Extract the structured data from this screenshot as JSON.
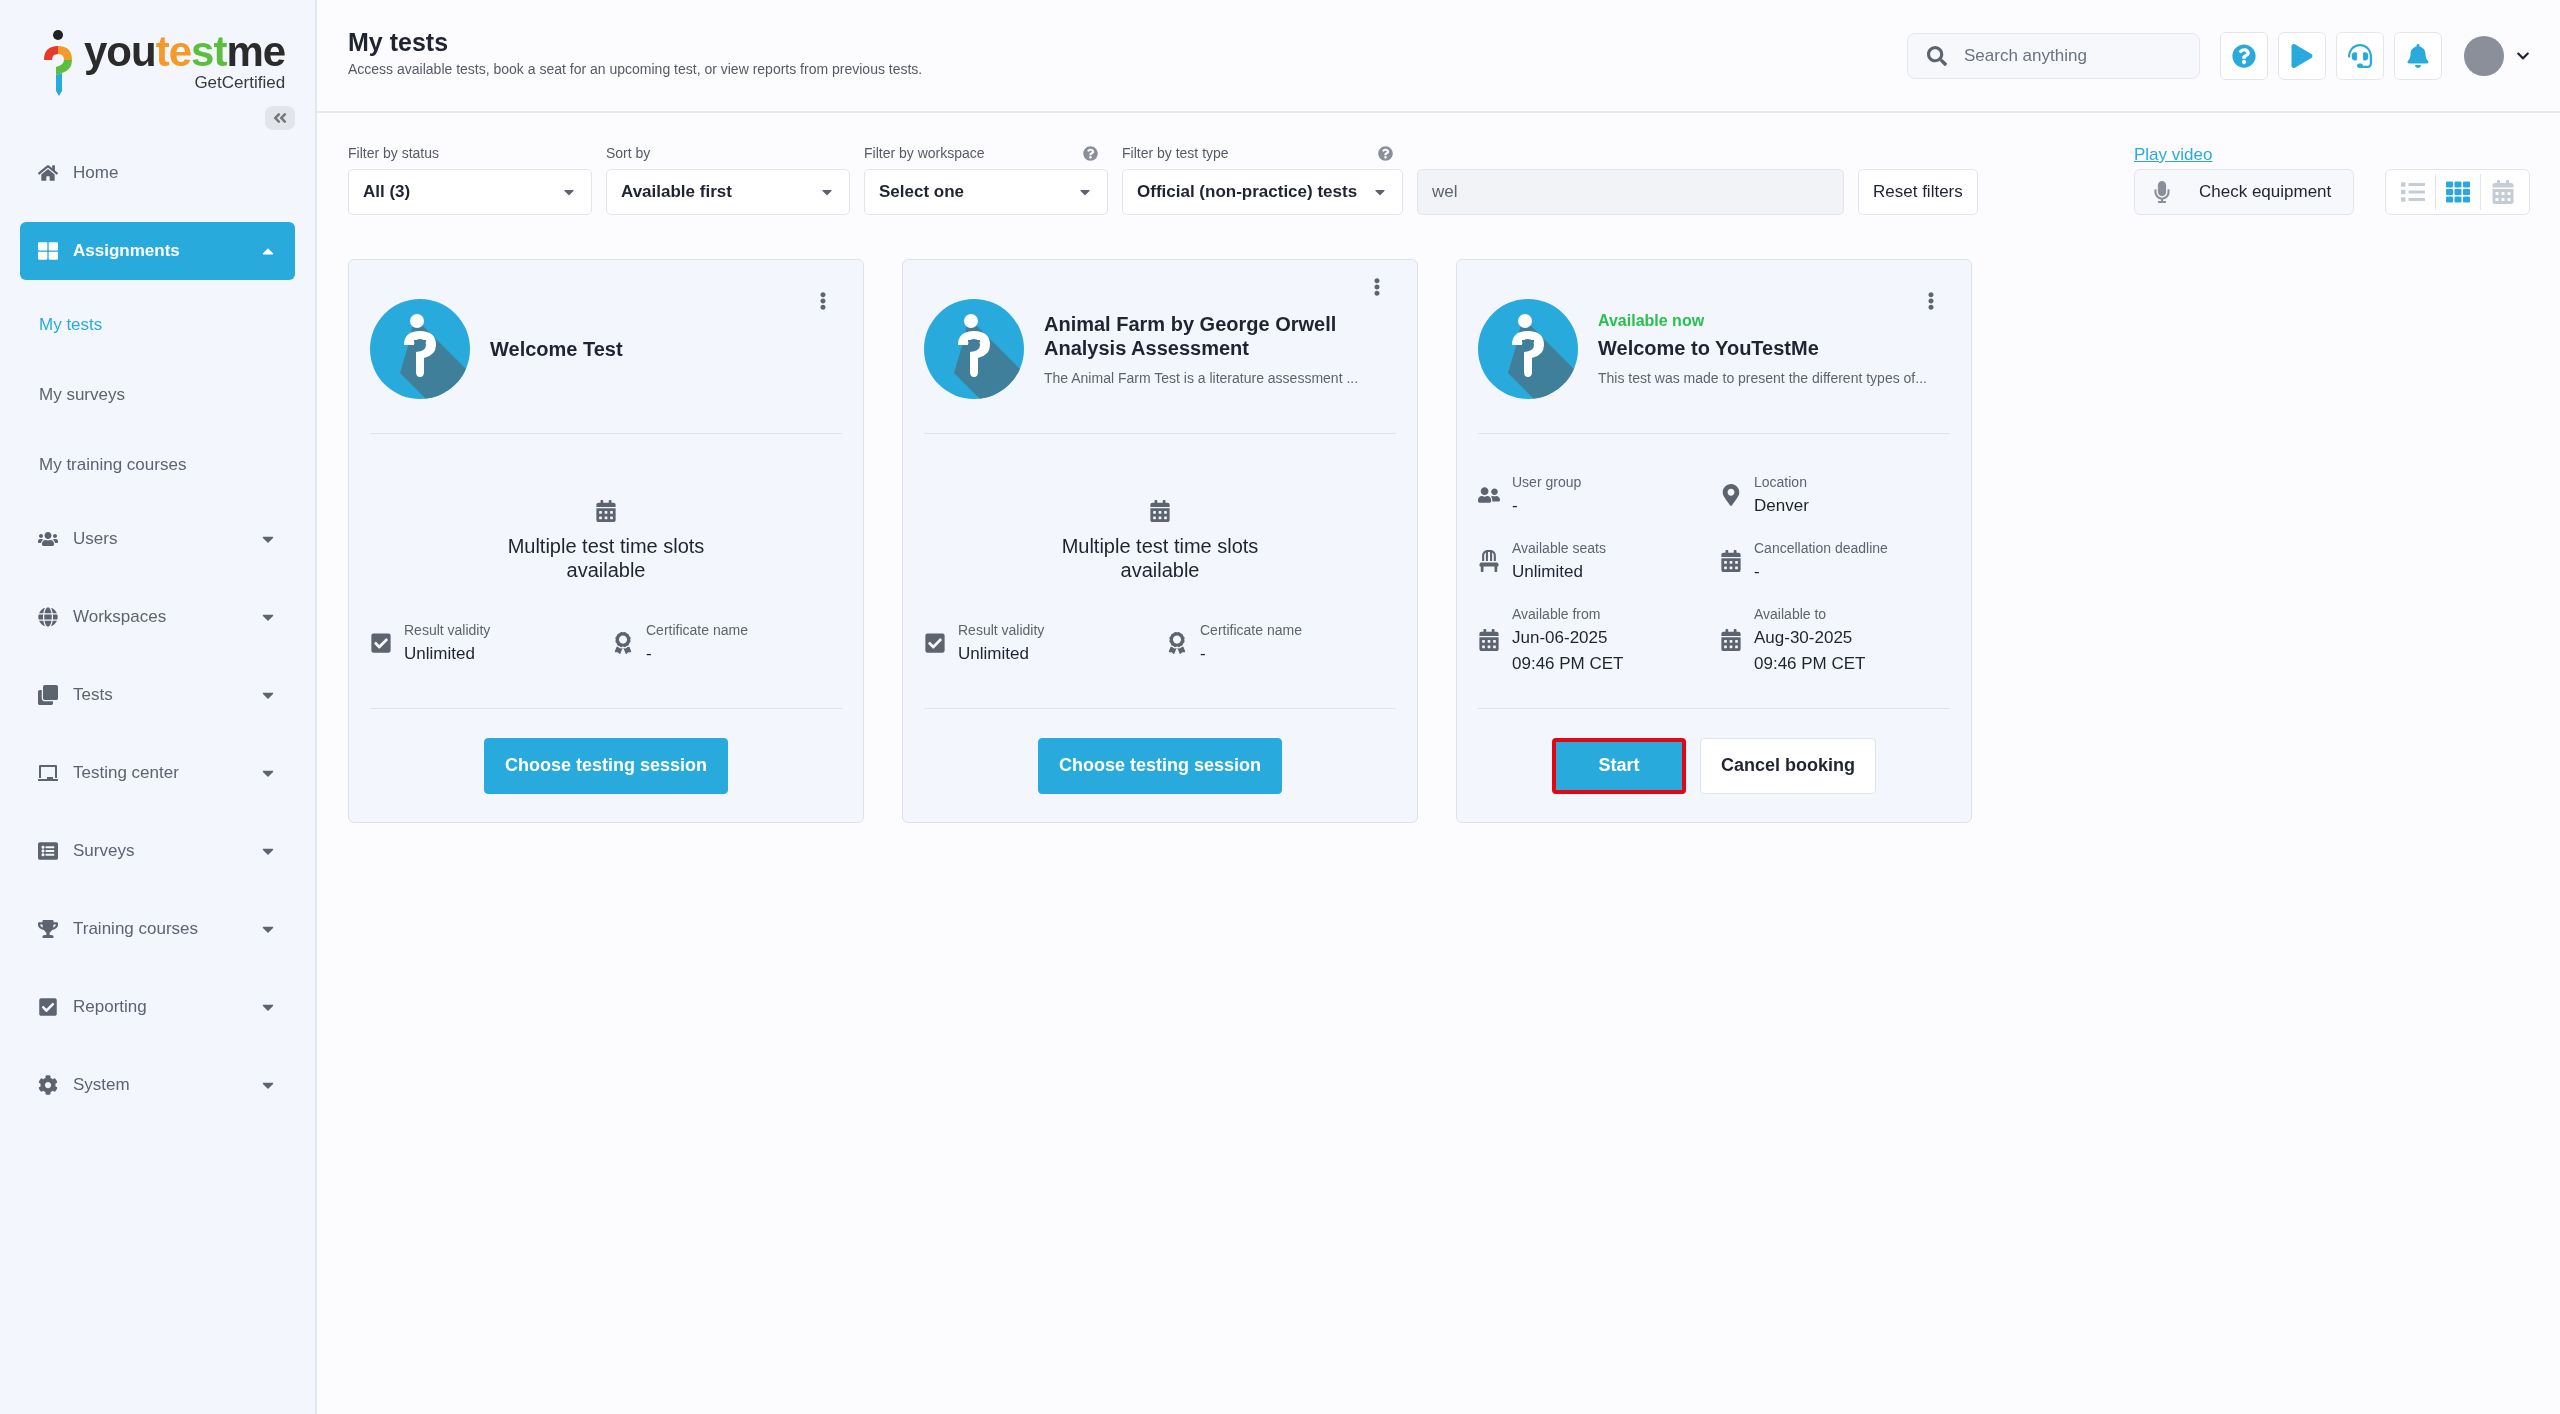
{
  "sidebar": {
    "logo": {
      "wordmark": [
        {
          "text": "you",
          "color": "#2b2b2b"
        },
        {
          "text": "te",
          "color": "#f39a2b"
        },
        {
          "text": "st",
          "color": "#5cbf3c"
        },
        {
          "text": "me",
          "color": "#2b2b2b"
        }
      ],
      "tagline": "GetCertified"
    },
    "nav": [
      {
        "label": "Home",
        "kind": "link",
        "selected": false
      },
      {
        "label": "Assignments",
        "kind": "group",
        "selected": true,
        "expanded": true,
        "children": [
          {
            "label": "My tests",
            "selected": true
          },
          {
            "label": "My surveys",
            "selected": false
          },
          {
            "label": "My training courses",
            "selected": false
          }
        ]
      },
      {
        "label": "Users",
        "kind": "group",
        "selected": false,
        "expanded": false
      },
      {
        "label": "Workspaces",
        "kind": "group",
        "selected": false,
        "expanded": false
      },
      {
        "label": "Tests",
        "kind": "group",
        "selected": false,
        "expanded": false
      },
      {
        "label": "Testing center",
        "kind": "group",
        "selected": false,
        "expanded": false
      },
      {
        "label": "Surveys",
        "kind": "group",
        "selected": false,
        "expanded": false
      },
      {
        "label": "Training courses",
        "kind": "group",
        "selected": false,
        "expanded": false
      },
      {
        "label": "Reporting",
        "kind": "group",
        "selected": false,
        "expanded": false
      },
      {
        "label": "System",
        "kind": "group",
        "selected": false,
        "expanded": false
      }
    ]
  },
  "header": {
    "title": "My tests",
    "subtitle": "Access available tests, book a seat for an upcoming test, or view reports from previous tests.",
    "search": {
      "placeholder": "Search anything"
    }
  },
  "filters": [
    {
      "label": "Filter by status",
      "value": "All (3)",
      "help": false
    },
    {
      "label": "Sort by",
      "value": "Available first",
      "help": false
    },
    {
      "label": "Filter by workspace",
      "value": "Select one",
      "help": true
    },
    {
      "label": "Filter by test type",
      "value": "Official (non-practice) tests",
      "help": true
    }
  ],
  "search_field": {
    "value": "wel"
  },
  "reset_button": "Reset filters",
  "play_video": "Play video",
  "check_equipment": "Check equipment",
  "views": [
    {
      "kind": "list",
      "selected": false
    },
    {
      "kind": "grid",
      "selected": true
    },
    {
      "kind": "calendar",
      "selected": false
    }
  ],
  "cards": [
    {
      "title": "Welcome Test",
      "body": {
        "kind": "slots",
        "text": "Multiple test time slots available"
      },
      "details": [
        {
          "kind": "validity",
          "label": "Result validity",
          "value": "Unlimited"
        },
        {
          "kind": "certificate",
          "label": "Certificate name",
          "value": "-"
        }
      ],
      "buttons": [
        {
          "label": "Choose testing session",
          "kind": "primary",
          "highlighted": false
        }
      ]
    },
    {
      "title": "Animal Farm by George Orwell Analysis Assessment",
      "description": "The Animal Farm Test is a literature assessment ...",
      "body": {
        "kind": "slots",
        "text": "Multiple test time slots available"
      },
      "details": [
        {
          "kind": "validity",
          "label": "Result validity",
          "value": "Unlimited"
        },
        {
          "kind": "certificate",
          "label": "Certificate name",
          "value": "-"
        }
      ],
      "buttons": [
        {
          "label": "Choose testing session",
          "kind": "primary",
          "highlighted": false
        }
      ]
    },
    {
      "status": "Available now",
      "title": "Welcome to YouTestMe",
      "description": "This test was made to present the different types of...",
      "body": {
        "kind": "booked"
      },
      "details": [
        {
          "kind": "group",
          "label": "User group",
          "value": "-"
        },
        {
          "kind": "location",
          "label": "Location",
          "value": "Denver"
        },
        {
          "kind": "seats",
          "label": "Available seats",
          "value": "Unlimited"
        },
        {
          "kind": "deadline",
          "label": "Cancellation deadline",
          "value": "-"
        },
        {
          "kind": "date",
          "label": "Available from",
          "value": "Jun-06-2025",
          "time": "09:46 PM CET"
        },
        {
          "kind": "date",
          "label": "Available to",
          "value": "Aug-30-2025",
          "time": "09:46 PM CET"
        }
      ],
      "buttons": [
        {
          "label": "Start",
          "kind": "primary",
          "highlighted": true
        },
        {
          "label": "Cancel booking",
          "kind": "secondary",
          "highlighted": false
        }
      ]
    }
  ]
}
